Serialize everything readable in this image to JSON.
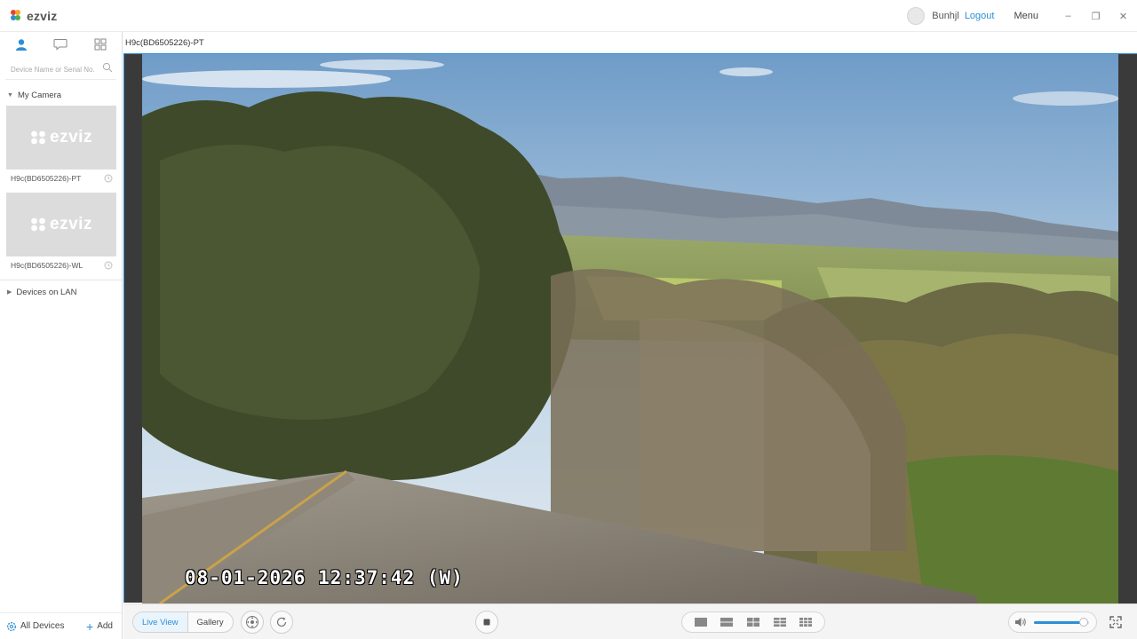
{
  "app": {
    "logo_text": "ezviz"
  },
  "titlebar": {
    "username": "Bunhjl",
    "logout_label": "Logout",
    "menu_label": "Menu",
    "minimize": "–",
    "restore": "❐",
    "close": "✕"
  },
  "sidebar": {
    "tabs": [
      "user-icon",
      "chat-icon",
      "grid-icon"
    ],
    "search_placeholder": "Device Name or Serial No.",
    "group_my_camera": "My Camera",
    "cameras": [
      {
        "name": "H9c(BD6505226)-PT",
        "thumb_text": "ezviz"
      },
      {
        "name": "H9c(BD6505226)-WL",
        "thumb_text": "ezviz"
      }
    ],
    "group_lan": "Devices on LAN",
    "bottom": {
      "all_devices": "All Devices",
      "add": "Add"
    }
  },
  "main": {
    "channel_title": "H9c(BD6505226)-PT",
    "osd_timestamp": "08-01-2026 12:37:42  (W)"
  },
  "toolbar": {
    "live_view_label": "Live View",
    "gallery_label": "Gallery",
    "volume_level": 0.9
  },
  "colors": {
    "accent": "#2b8fd6",
    "frame_bg": "#3a3a3a"
  }
}
